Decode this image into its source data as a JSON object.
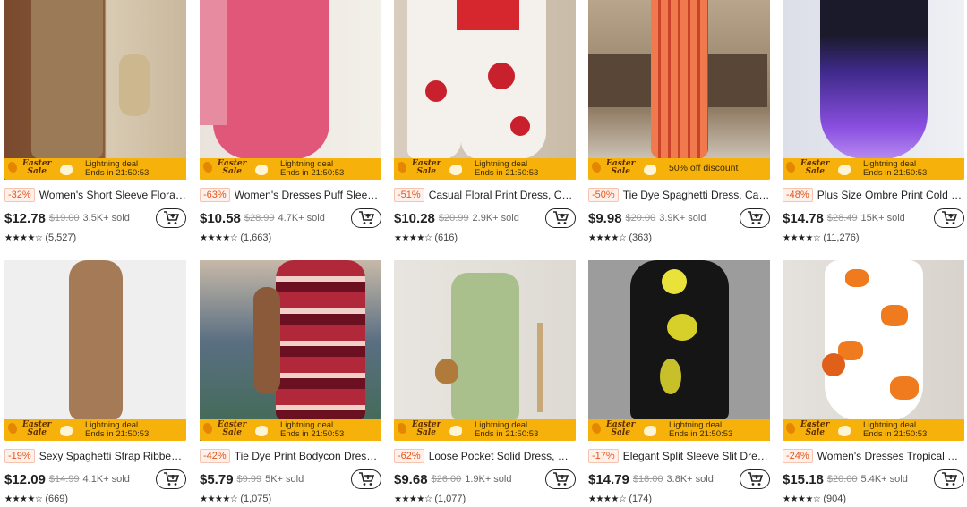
{
  "products": [
    {
      "discount": "-32%",
      "title": "Women's Short Sleeve Floral ...",
      "price": "$12.78",
      "original_price": "$19.00",
      "sold": "3.5K+ sold",
      "stars": "★★★★☆",
      "reviews": "(5,527)",
      "banner": {
        "badge": "Easter Sale",
        "line1": "Lightning deal",
        "line2": "Ends in 21:50:53"
      },
      "image_colors": {
        "bg": "#c9b89d",
        "dress": "#9b7a58"
      }
    },
    {
      "discount": "-63%",
      "title": "Women's Dresses Puff Sleeve...",
      "price": "$10.58",
      "original_price": "$28.99",
      "sold": "4.7K+ sold",
      "stars": "★★★★☆",
      "reviews": "(1,663)",
      "banner": {
        "badge": "Easter Sale",
        "line1": "Lightning deal",
        "line2": "Ends in 21:50:53"
      },
      "image_colors": {
        "bg": "#e9e3dc",
        "dress": "#e0577a"
      }
    },
    {
      "discount": "-51%",
      "title": "Casual Floral Print Dress, Cre...",
      "price": "$10.28",
      "original_price": "$20.99",
      "sold": "2.9K+ sold",
      "stars": "★★★★☆",
      "reviews": "(616)",
      "banner": {
        "badge": "Easter Sale",
        "line1": "Lightning deal",
        "line2": "Ends in 21:50:53"
      },
      "image_colors": {
        "bg": "#d8cdbf",
        "dress": "#f4f0ec"
      }
    },
    {
      "discount": "-50%",
      "title": "Tie Dye Spaghetti Dress, Cas...",
      "price": "$9.98",
      "original_price": "$20.00",
      "sold": "3.9K+ sold",
      "stars": "★★★★☆",
      "reviews": "(363)",
      "banner": {
        "badge": "Easter Sale",
        "line1": "50% off discount",
        "line2": ""
      },
      "image_colors": {
        "bg": "#b9a58c",
        "dress": "#f07a4d"
      }
    },
    {
      "discount": "-48%",
      "title": "Plus Size Ombre Print Cold S...",
      "price": "$14.78",
      "original_price": "$28.49",
      "sold": "15K+ sold",
      "stars": "★★★★☆",
      "reviews": "(11,276)",
      "banner": {
        "badge": "Easter Sale",
        "line1": "Lightning deal",
        "line2": "Ends in 21:50:53"
      },
      "image_colors": {
        "bg": "#dcdfe8",
        "dress": "#6b3fc4"
      }
    },
    {
      "discount": "-19%",
      "title": "Sexy Spaghetti Strap Ribbed ...",
      "price": "$12.09",
      "original_price": "$14.99",
      "sold": "4.1K+ sold",
      "stars": "★★★★☆",
      "reviews": "(669)",
      "banner": {
        "badge": "Easter Sale",
        "line1": "Lightning deal",
        "line2": "Ends in 21:50:53"
      },
      "image_colors": {
        "bg": "#efefef",
        "dress": "#a57a56"
      }
    },
    {
      "discount": "-42%",
      "title": "Tie Dye Print Bodycon Dress, ...",
      "price": "$5.79",
      "original_price": "$9.99",
      "sold": "5K+ sold",
      "stars": "★★★★☆",
      "reviews": "(1,075)",
      "banner": {
        "badge": "Easter Sale",
        "line1": "Lightning deal",
        "line2": "Ends in 21:50:53"
      },
      "image_colors": {
        "bg": "#5a6f82",
        "dress": "#b0283a"
      }
    },
    {
      "discount": "-62%",
      "title": "Loose Pocket Solid Dress, Cas...",
      "price": "$9.68",
      "original_price": "$26.00",
      "sold": "1.9K+ sold",
      "stars": "★★★★☆",
      "reviews": "(1,077)",
      "banner": {
        "badge": "Easter Sale",
        "line1": "Lightning deal",
        "line2": "Ends in 21:50:53"
      },
      "image_colors": {
        "bg": "#e8e5e0",
        "dress": "#a9c08d"
      }
    },
    {
      "discount": "-17%",
      "title": "Elegant Split Sleeve Slit Dress...",
      "price": "$14.79",
      "original_price": "$18.00",
      "sold": "3.8K+ sold",
      "stars": "★★★★☆",
      "reviews": "(174)",
      "banner": {
        "badge": "Easter Sale",
        "line1": "Lightning deal",
        "line2": "Ends in 21:50:53"
      },
      "image_colors": {
        "bg": "#9c9c9c",
        "dress": "#151515"
      }
    },
    {
      "discount": "-24%",
      "title": "Women's Dresses Tropical Pri...",
      "price": "$15.18",
      "original_price": "$20.00",
      "sold": "5.4K+ sold",
      "stars": "★★★★☆",
      "reviews": "(904)",
      "banner": {
        "badge": "Easter Sale",
        "line1": "Lightning deal",
        "line2": "Ends in 21:50:53"
      },
      "image_colors": {
        "bg": "#e5e2de",
        "dress": "#f07a1e"
      }
    }
  ],
  "colors": {
    "banner": "#f6b20a",
    "discount_text": "#e1561f"
  }
}
